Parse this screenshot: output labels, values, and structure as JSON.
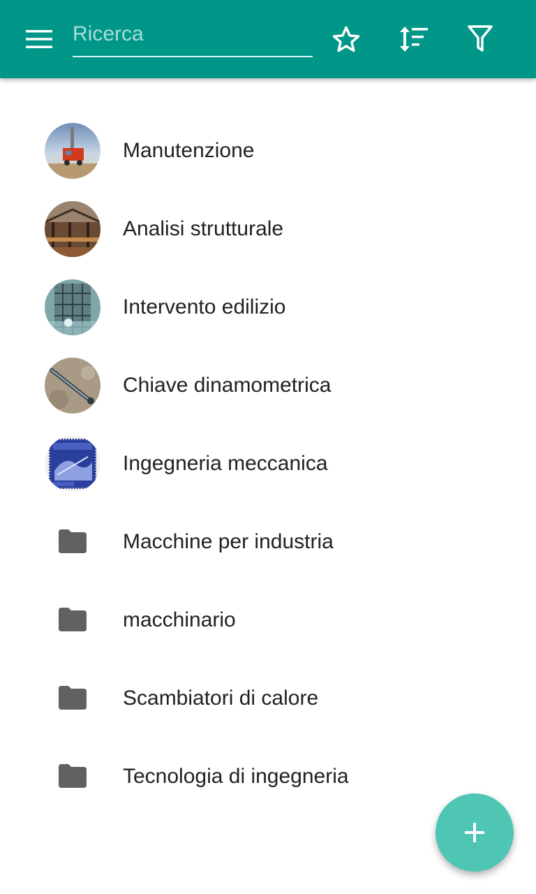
{
  "appbar": {
    "color": "#009688",
    "menu_icon": "menu-icon",
    "search": {
      "placeholder": "Ricerca",
      "value": ""
    },
    "actions": [
      {
        "icon": "star-outline-icon"
      },
      {
        "icon": "sort-icon"
      },
      {
        "icon": "filter-icon"
      }
    ]
  },
  "items": [
    {
      "label": "Manutenzione",
      "type": "image",
      "thumb": "drilling-rig-photo"
    },
    {
      "label": "Analisi strutturale",
      "type": "image",
      "thumb": "building-construction-photo"
    },
    {
      "label": "Intervento edilizio",
      "type": "image",
      "thumb": "scaffolding-building-photo"
    },
    {
      "label": "Chiave dinamometrica",
      "type": "image",
      "thumb": "torque-wrench-photo"
    },
    {
      "label": "Ingegneria meccanica",
      "type": "image",
      "thumb": "blue-stamp-image"
    },
    {
      "label": "Macchine per industria",
      "type": "folder",
      "icon": "folder-icon"
    },
    {
      "label": "macchinario",
      "type": "folder",
      "icon": "folder-icon"
    },
    {
      "label": "Scambiatori di calore",
      "type": "folder",
      "icon": "folder-icon"
    },
    {
      "label": "Tecnologia di ingegneria",
      "type": "folder",
      "icon": "folder-icon"
    }
  ],
  "fab": {
    "icon": "add-icon",
    "color": "#4fc5b4"
  }
}
